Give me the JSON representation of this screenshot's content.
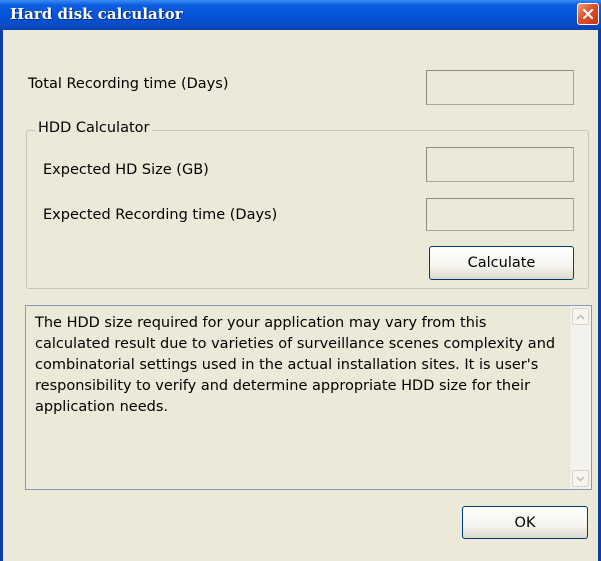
{
  "window": {
    "title": "Hard disk calculator"
  },
  "total_recording": {
    "label": "Total Recording time (Days)",
    "value": ""
  },
  "hdd_calculator": {
    "legend": "HDD Calculator",
    "hd_size": {
      "label": "Expected HD Size (GB)",
      "value": ""
    },
    "recording_time": {
      "label": "Expected Recording time (Days)",
      "value": ""
    },
    "calculate_label": "Calculate"
  },
  "notice": {
    "text": "The HDD size required for your application may vary from this calculated result due to varieties of surveillance scenes complexity and combinatorial settings used in the actual installation sites. It is user's responsibility to verify and determine appropriate HDD size for their application needs."
  },
  "ok_label": "OK",
  "icons": {
    "close": "close-icon",
    "scroll_up": "scroll-up-icon",
    "scroll_down": "scroll-down-icon"
  },
  "colors": {
    "titlebar": "#0653d6",
    "dialog_bg": "#ece9d8",
    "close_button": "#e0502a",
    "button_border": "#003c74"
  }
}
